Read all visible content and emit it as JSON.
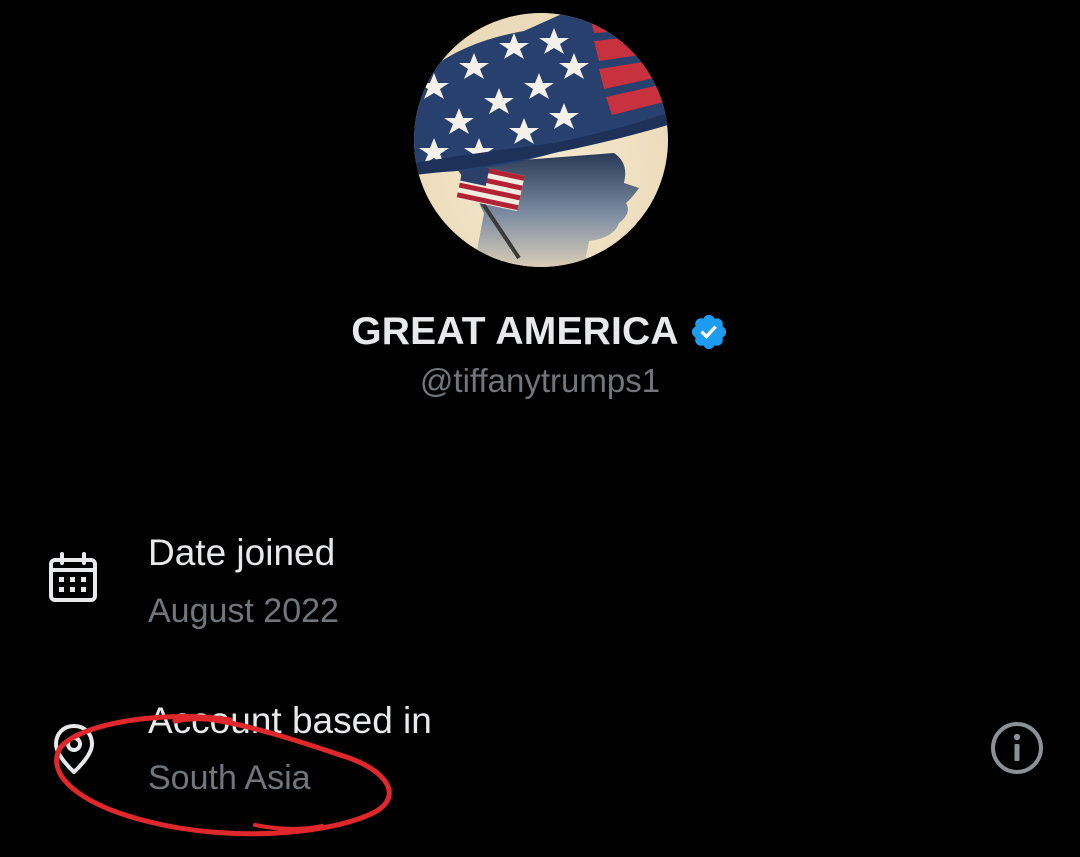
{
  "profile": {
    "display_name": "GREAT AMERICA",
    "handle": "@tiffanytrumps1",
    "verified": true,
    "verified_color": "#1d9bf0",
    "avatar_icon": "profile-avatar-flag-hat-silhouette"
  },
  "details": {
    "date_joined": {
      "label": "Date joined",
      "value": "August 2022",
      "icon": "calendar-icon"
    },
    "account_location": {
      "label": "Account based in",
      "value": "South Asia",
      "icon": "location-pin-icon",
      "info_icon": "info-icon"
    }
  },
  "annotation": {
    "type": "hand-drawn red circle",
    "color": "#e0272b"
  },
  "colors": {
    "background": "#000000",
    "primary_text": "#e7e9ea",
    "secondary_text": "#71767b"
  }
}
